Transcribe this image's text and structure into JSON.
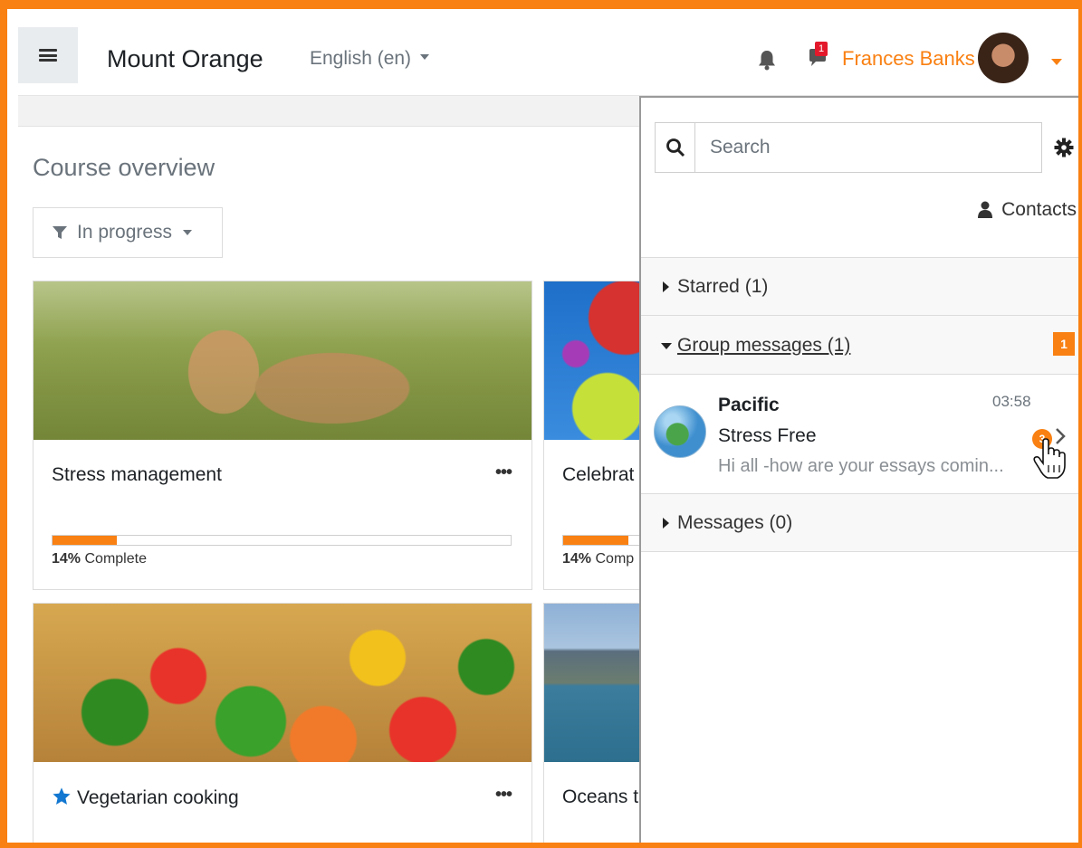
{
  "header": {
    "site_name": "Mount Orange",
    "language": "English (en)",
    "notification_count": "1",
    "user_name": "Frances Banks"
  },
  "course_overview": {
    "title": "Course overview",
    "filter_label": "In progress"
  },
  "courses": [
    {
      "name": "Stress management",
      "progress_percent": 14,
      "progress_label": "14%",
      "complete_label": "Complete",
      "starred": false
    },
    {
      "name": "Celebrat",
      "progress_percent": 14,
      "progress_label": "14%",
      "complete_label": "Comp",
      "starred": false
    },
    {
      "name": "Vegetarian cooking",
      "starred": true
    },
    {
      "name": "Oceans t",
      "starred": false
    }
  ],
  "card_menu": "•••",
  "drawer": {
    "search_placeholder": "Search",
    "contacts_label": "Contacts",
    "starred_label": "Starred (1)",
    "group_messages_label": "Group messages (1)",
    "group_unread": "1",
    "messages_label": "Messages (0)",
    "conversation": {
      "name": "Pacific",
      "time": "03:58",
      "subject": "Stress Free",
      "preview": "Hi all -how are your essays comin...",
      "unread_count": "3"
    }
  },
  "colors": {
    "accent": "#f98012",
    "badge_red": "#e3192b"
  }
}
